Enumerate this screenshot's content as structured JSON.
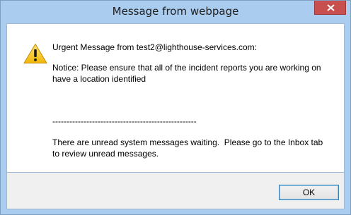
{
  "window": {
    "title": "Message from webpage"
  },
  "icons": {
    "warning": "warning-icon",
    "close": "close-icon"
  },
  "message": {
    "line1": "Urgent Message from test2@lighthouse-services.com:",
    "line2": "Notice: Please ensure that all of the incident reports you are working on\nhave a location identified",
    "separator": "---------------------------------------------------",
    "line3": "There are unread system messages waiting.  Please go to the Inbox tab\nto review unread messages."
  },
  "buttons": {
    "ok_label": "OK"
  },
  "colors": {
    "frame": "#aaccee",
    "close_button": "#c7504f",
    "footer": "#f0f0f0"
  }
}
